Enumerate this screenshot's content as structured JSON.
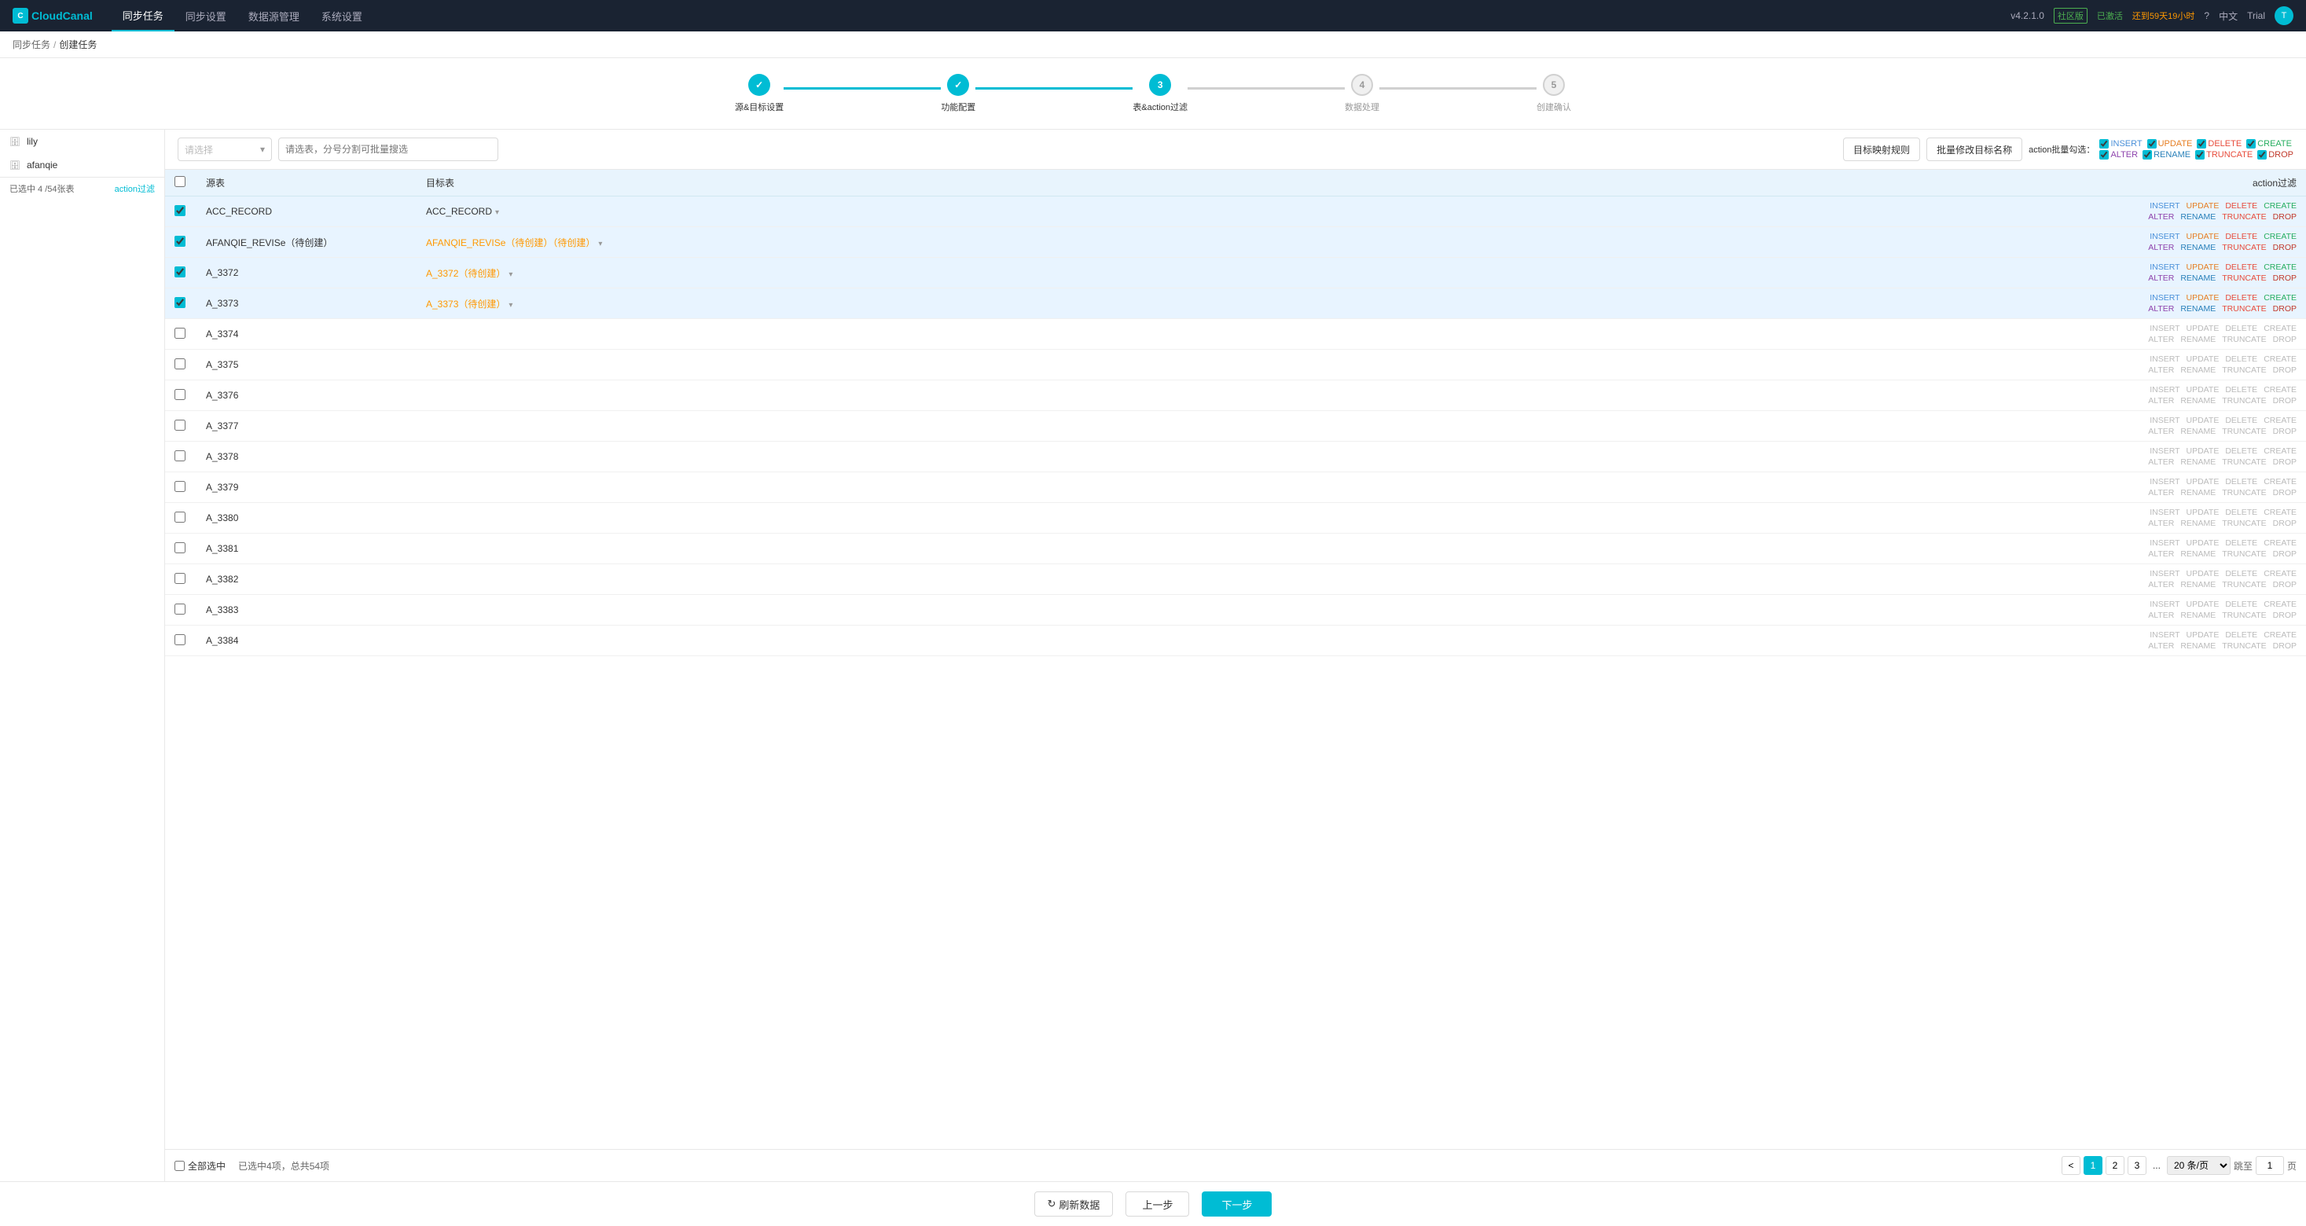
{
  "app": {
    "name": "CloudCanal",
    "version": "v4.2.1.0",
    "edition": "社区版",
    "edition_status": "已激活",
    "trial_countdown": "还到59天19小时",
    "language": "中文",
    "user": "Trial"
  },
  "nav": {
    "items": [
      {
        "label": "同步任务",
        "active": true
      },
      {
        "label": "同步设置",
        "active": false
      },
      {
        "label": "数据源管理",
        "active": false
      },
      {
        "label": "系统设置",
        "active": false
      }
    ]
  },
  "breadcrumb": {
    "parent": "同步任务",
    "current": "创建任务"
  },
  "stepper": {
    "steps": [
      {
        "label": "源&目标设置",
        "state": "done",
        "num": "✓"
      },
      {
        "label": "功能配置",
        "state": "done",
        "num": "✓"
      },
      {
        "label": "表&action过滤",
        "state": "active",
        "num": "3"
      },
      {
        "label": "数据处理",
        "state": "pending",
        "num": "4"
      },
      {
        "label": "创建确认",
        "state": "pending",
        "num": "5"
      }
    ]
  },
  "sidebar": {
    "databases": [
      {
        "name": "lily",
        "icon": "db"
      },
      {
        "name": "afanqie",
        "icon": "db"
      }
    ],
    "selected_count": "已选中 4 /54张表",
    "action_filter_link": "action过滤"
  },
  "toolbar": {
    "search_select_placeholder": "请选择",
    "search_input_placeholder": "请选表，分号分割可批量搜选",
    "btn_target_mapping": "目标映射规则",
    "btn_batch_rename": "批量修改目标名称",
    "action_batch_label": "action批量勾选：",
    "actions_row1": [
      {
        "key": "INSERT",
        "label": "INSERT",
        "color": "insert"
      },
      {
        "key": "UPDATE",
        "label": "UPDATE",
        "color": "update"
      },
      {
        "key": "DELETE",
        "label": "DELETE",
        "color": "delete"
      },
      {
        "key": "CREATE",
        "label": "CREATE",
        "color": "create"
      }
    ],
    "actions_row2": [
      {
        "key": "ALTER",
        "label": "ALTER",
        "color": "alter"
      },
      {
        "key": "RENAME",
        "label": "RENAME",
        "color": "rename"
      },
      {
        "key": "TRUNCATE",
        "label": "TRUNCATE",
        "color": "truncate"
      },
      {
        "key": "DROP",
        "label": "DROP",
        "color": "drop"
      }
    ]
  },
  "table": {
    "col_checkbox": "",
    "col_source": "源表",
    "col_target": "目标表",
    "col_action_filter": "action过滤",
    "rows": [
      {
        "id": 1,
        "checked": true,
        "source": "ACC_RECORD",
        "target": "ACC_RECORD",
        "target_pending": false,
        "actions": {
          "insert": true,
          "update": true,
          "delete": true,
          "create": true,
          "alter": true,
          "rename": true,
          "truncate": true,
          "drop": true
        }
      },
      {
        "id": 2,
        "checked": true,
        "source": "AFANQIE_REVISe（待创建）",
        "target": "AFANQIE_REVISe（待创建）（待创建）",
        "target_pending": true,
        "actions": {
          "insert": true,
          "update": true,
          "delete": true,
          "create": true,
          "alter": true,
          "rename": true,
          "truncate": true,
          "drop": true
        }
      },
      {
        "id": 3,
        "checked": true,
        "source": "A_3372",
        "target": "A_3372（待创建）",
        "target_pending": true,
        "actions": {
          "insert": true,
          "update": true,
          "delete": true,
          "create": true,
          "alter": true,
          "rename": true,
          "truncate": true,
          "drop": true
        }
      },
      {
        "id": 4,
        "checked": true,
        "source": "A_3373",
        "target": "A_3373（待创建）",
        "target_pending": true,
        "actions": {
          "insert": true,
          "update": true,
          "delete": true,
          "create": true,
          "alter": true,
          "rename": true,
          "truncate": true,
          "drop": true
        }
      },
      {
        "id": 5,
        "checked": false,
        "source": "A_3374",
        "target": "",
        "target_pending": false,
        "actions": {
          "insert": false,
          "update": false,
          "delete": false,
          "create": false,
          "alter": false,
          "rename": false,
          "truncate": false,
          "drop": false
        }
      },
      {
        "id": 6,
        "checked": false,
        "source": "A_3375",
        "target": "",
        "target_pending": false,
        "actions": {
          "insert": false,
          "update": false,
          "delete": false,
          "create": false,
          "alter": false,
          "rename": false,
          "truncate": false,
          "drop": false
        }
      },
      {
        "id": 7,
        "checked": false,
        "source": "A_3376",
        "target": "",
        "target_pending": false,
        "actions": {
          "insert": false,
          "update": false,
          "delete": false,
          "create": false,
          "alter": false,
          "rename": false,
          "truncate": false,
          "drop": false
        }
      },
      {
        "id": 8,
        "checked": false,
        "source": "A_3377",
        "target": "",
        "target_pending": false,
        "actions": {
          "insert": false,
          "update": false,
          "delete": false,
          "create": false,
          "alter": false,
          "rename": false,
          "truncate": false,
          "drop": false
        }
      },
      {
        "id": 9,
        "checked": false,
        "source": "A_3378",
        "target": "",
        "target_pending": false,
        "actions": {
          "insert": false,
          "update": false,
          "delete": false,
          "create": false,
          "alter": false,
          "rename": false,
          "truncate": false,
          "drop": false
        }
      },
      {
        "id": 10,
        "checked": false,
        "source": "A_3379",
        "target": "",
        "target_pending": false,
        "actions": {
          "insert": false,
          "update": false,
          "delete": false,
          "create": false,
          "alter": false,
          "rename": false,
          "truncate": false,
          "drop": false
        }
      },
      {
        "id": 11,
        "checked": false,
        "source": "A_3380",
        "target": "",
        "target_pending": false,
        "actions": {
          "insert": false,
          "update": false,
          "delete": false,
          "create": false,
          "alter": false,
          "rename": false,
          "truncate": false,
          "drop": false
        }
      },
      {
        "id": 12,
        "checked": false,
        "source": "A_3381",
        "target": "",
        "target_pending": false,
        "actions": {
          "insert": false,
          "update": false,
          "delete": false,
          "create": false,
          "alter": false,
          "rename": false,
          "truncate": false,
          "drop": false
        }
      },
      {
        "id": 13,
        "checked": false,
        "source": "A_3382",
        "target": "",
        "target_pending": false,
        "actions": {
          "insert": false,
          "update": false,
          "delete": false,
          "create": false,
          "alter": false,
          "rename": false,
          "truncate": false,
          "drop": false
        }
      },
      {
        "id": 14,
        "checked": false,
        "source": "A_3383",
        "target": "",
        "target_pending": false,
        "actions": {
          "insert": false,
          "update": false,
          "delete": false,
          "create": false,
          "alter": false,
          "rename": false,
          "truncate": false,
          "drop": false
        }
      },
      {
        "id": 15,
        "checked": false,
        "source": "A_3384",
        "target": "",
        "target_pending": false,
        "actions": {
          "insert": false,
          "update": false,
          "delete": false,
          "create": false,
          "alter": false,
          "rename": false,
          "truncate": false,
          "drop": false
        }
      }
    ]
  },
  "footer": {
    "select_all": "全部选中",
    "selected_info": "已选中4项，总共54项",
    "pagination": {
      "prev": "<",
      "page1": "1",
      "page2": "2",
      "page3": "3",
      "ellipsis": "...",
      "page_size_label": "20 条/页",
      "goto_label": "跳至",
      "goto_end": "页",
      "current_page": "1"
    }
  },
  "bottom_bar": {
    "refresh_btn": "⟳刷新数据",
    "prev_btn": "上一步",
    "next_btn": "下一步"
  }
}
